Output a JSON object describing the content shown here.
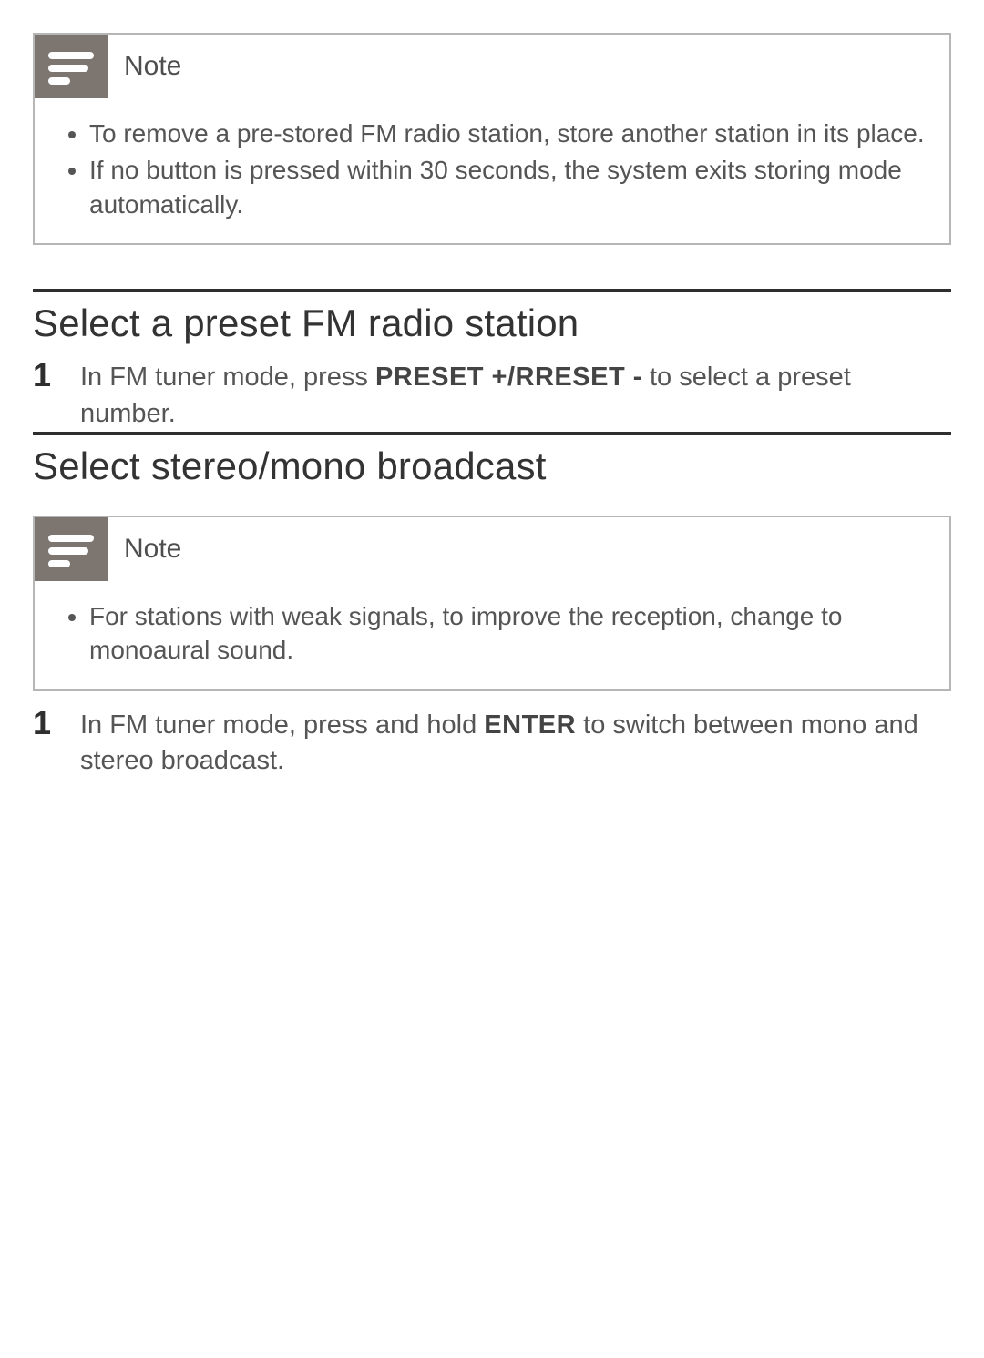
{
  "noteLabel": "Note",
  "note1": {
    "items": [
      "To remove a pre-stored FM radio station, store another station in its place.",
      "If no button is pressed within 30 seconds, the system exits storing mode automatically."
    ]
  },
  "section1": {
    "title": "Select a preset FM radio station",
    "step1Num": "1",
    "step1_pre": "In FM tuner mode, press ",
    "step1_bold": "PRESET +/RRESET -",
    "step1_post": " to select a preset number."
  },
  "section2": {
    "title": "Select stereo/mono broadcast"
  },
  "note2": {
    "items": [
      "For stations with weak signals, to improve the reception, change to monoaural sound."
    ]
  },
  "section2step": {
    "num": "1",
    "pre": "In FM tuner mode, press and hold ",
    "bold": "ENTER",
    "post": " to switch between mono and stereo broadcast."
  }
}
